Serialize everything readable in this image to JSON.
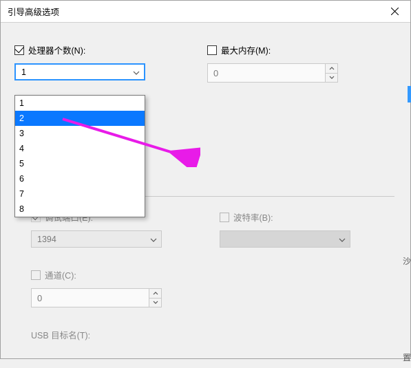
{
  "window": {
    "title": "引导高级选项"
  },
  "processors": {
    "checkbox_label": "处理器个数(N):",
    "checked": true,
    "selected": "1",
    "options": [
      "1",
      "2",
      "3",
      "4",
      "5",
      "6",
      "7",
      "8"
    ],
    "highlight_index": 1
  },
  "maxmem": {
    "checkbox_label": "最大内存(M):",
    "checked": false,
    "value": "0"
  },
  "debugport": {
    "checkbox_label": "调试端口(E):",
    "selected": "1394"
  },
  "baud": {
    "checkbox_label": "波特率(B):",
    "selected": ""
  },
  "channel": {
    "checkbox_label": "通道(C):",
    "value": "0"
  },
  "usb": {
    "label": "USB 目标名(T):"
  },
  "edge_char": "沙",
  "edge_char2": "置"
}
